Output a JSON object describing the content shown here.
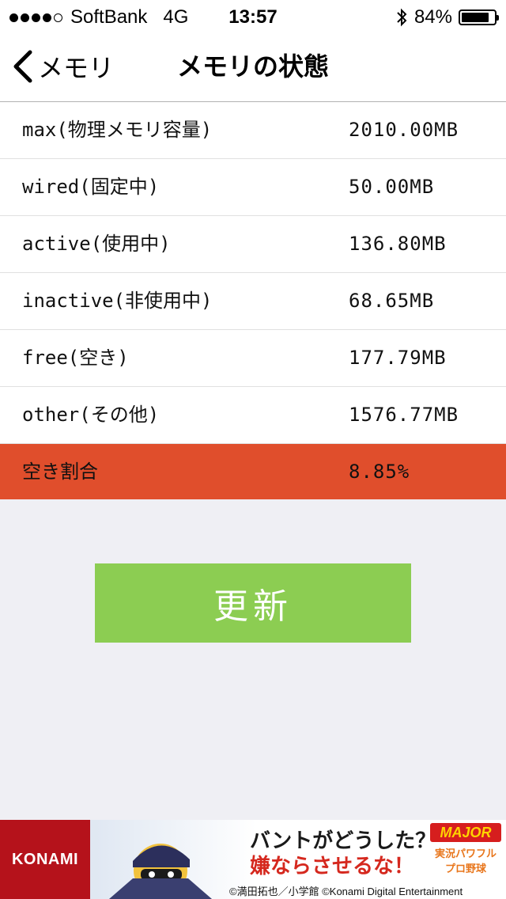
{
  "status_bar": {
    "carrier": "SoftBank",
    "network": "4G",
    "time": "13:57",
    "battery_percent_label": "84%",
    "battery_level": 0.84
  },
  "nav": {
    "back_label": "メモリ",
    "title": "メモリの状態"
  },
  "rows": [
    {
      "label": "max(物理メモリ容量)",
      "value": "2010.00MB"
    },
    {
      "label": "wired(固定中)",
      "value": "50.00MB"
    },
    {
      "label": "active(使用中)",
      "value": "136.80MB"
    },
    {
      "label": "inactive(非使用中)",
      "value": "68.65MB"
    },
    {
      "label": "free(空き)",
      "value": "177.79MB"
    },
    {
      "label": "other(その他)",
      "value": "1576.77MB"
    }
  ],
  "summary": {
    "label": "空き割合",
    "value": "8.85%"
  },
  "refresh_label": "更新",
  "ad": {
    "brand": "KONAMI",
    "headline": "バントがどうした？",
    "subline": "嫌ならさせるな！",
    "game_badge": "MAJOR",
    "game_title": "実況パワフルプロ野球",
    "copyright": "©満田拓也／小学館 ©Konami Digital Entertainment"
  },
  "colors": {
    "highlight": "#e04e2c",
    "refresh": "#8ccd52",
    "konami": "#b5121b"
  }
}
